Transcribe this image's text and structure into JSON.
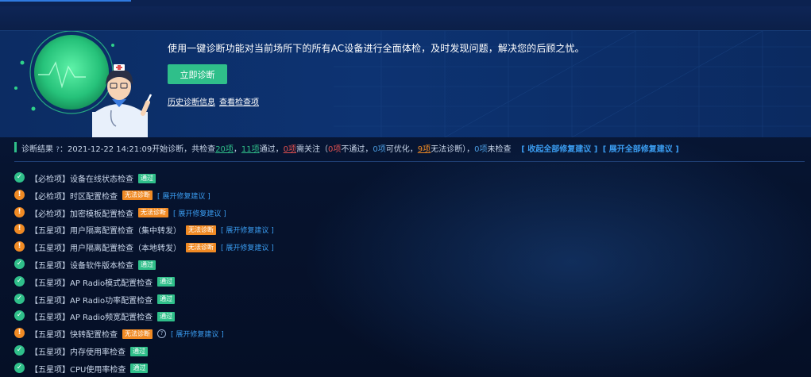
{
  "hero": {
    "description": "使用一键诊断功能对当前场所下的所有AC设备进行全面体检，及时发现问题，解决您的后顾之忧。",
    "start_button": "立即诊断",
    "history_link": "历史诊断信息",
    "items_link": "查看检查项"
  },
  "summary": {
    "label": "诊断结果",
    "help_glyph": "?",
    "pre_time": "：",
    "time": "2021-12-22 14:21:09",
    "s1": "开始诊断，共检查",
    "total": "20项",
    "s2": "，",
    "pass_count": "11项",
    "s3": "通过，",
    "attention_count": "0项",
    "s4": "需关注（",
    "fail_count": "0项",
    "s5": "不通过，",
    "optimize_count": "0项",
    "s6": "可优化，",
    "unable_count": "9项",
    "s7": "无法诊断），",
    "unchecked_count": "0项",
    "s8": "未检查",
    "collapse_all": "[ 收起全部修复建议 ]",
    "expand_all": "[ 展开全部修复建议 ]"
  },
  "status_glyphs": {
    "pass": "✓",
    "warn": "!"
  },
  "checks": [
    {
      "label": "【必检项】设备在线状态检查",
      "status": "pass",
      "badge": "通过"
    },
    {
      "label": "【必检项】时区配置检查",
      "status": "warn",
      "badge": "无法诊断",
      "link": "[ 展开修复建议 ]"
    },
    {
      "label": "【必检项】加密模板配置检查",
      "status": "warn",
      "badge": "无法诊断",
      "link": "[ 展开修复建议 ]"
    },
    {
      "label": "【五星项】用户隔离配置检查（集中转发）",
      "status": "warn",
      "badge": "无法诊断",
      "link": "[ 展开修复建议 ]"
    },
    {
      "label": "【五星项】用户隔离配置检查（本地转发）",
      "status": "warn",
      "badge": "无法诊断",
      "link": "[ 展开修复建议 ]"
    },
    {
      "label": "【五星项】设备软件版本检查",
      "status": "pass",
      "badge": "通过"
    },
    {
      "label": "【五星项】AP Radio模式配置检查",
      "status": "pass",
      "badge": "通过"
    },
    {
      "label": "【五星项】AP Radio功率配置检查",
      "status": "pass",
      "badge": "通过"
    },
    {
      "label": "【五星项】AP Radio频宽配置检查",
      "status": "pass",
      "badge": "通过"
    },
    {
      "label": "【五星项】快转配置检查",
      "status": "warn",
      "badge": "无法诊断",
      "help": "?",
      "link": "[ 展开修复建议 ]"
    },
    {
      "label": "【五星项】内存使用率检查",
      "status": "pass",
      "badge": "通过"
    },
    {
      "label": "【五星项】CPU使用率检查",
      "status": "pass",
      "badge": "通过"
    }
  ],
  "colors": {
    "pass": "#2fbf8a",
    "warn": "#f08a24",
    "fail": "#e05050",
    "link": "#3a9cf0"
  }
}
